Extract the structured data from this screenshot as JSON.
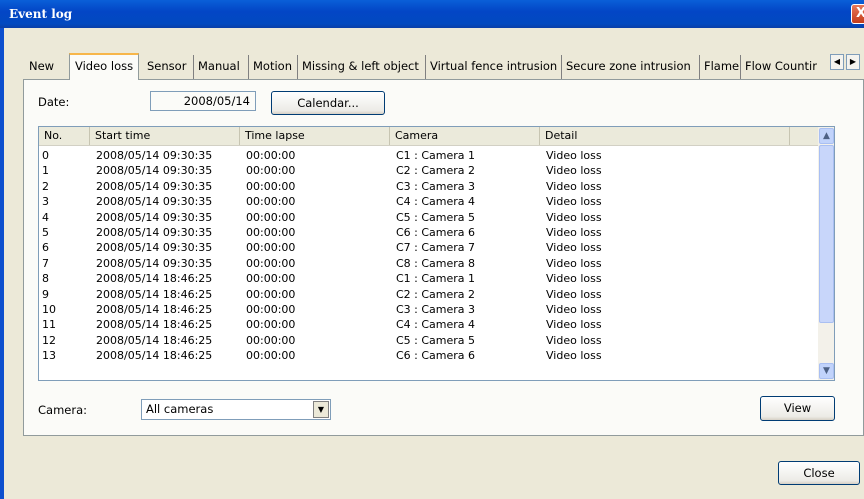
{
  "window": {
    "title": "Event log",
    "close_glyph": "X"
  },
  "tabs": [
    {
      "label": "New"
    },
    {
      "label": "Video loss"
    },
    {
      "label": "Sensor"
    },
    {
      "label": "Manual"
    },
    {
      "label": "Motion"
    },
    {
      "label": "Missing & left object"
    },
    {
      "label": "Virtual fence intrusion"
    },
    {
      "label": "Secure zone intrusion"
    },
    {
      "label": "Flame"
    },
    {
      "label": "Flow Countir"
    }
  ],
  "active_tab": "Video loss",
  "tab_nav": {
    "left_glyph": "◀",
    "right_glyph": "▶"
  },
  "date": {
    "label": "Date:",
    "value": "2008/05/14",
    "calendar_button": "Calendar..."
  },
  "table": {
    "columns": [
      "No.",
      "Start time",
      "Time lapse",
      "Camera",
      "Detail"
    ],
    "rows": [
      [
        "0",
        "2008/05/14 09:30:35",
        "00:00:00",
        "C1 : Camera 1",
        "Video loss"
      ],
      [
        "1",
        "2008/05/14 09:30:35",
        "00:00:00",
        "C2 : Camera 2",
        "Video loss"
      ],
      [
        "2",
        "2008/05/14 09:30:35",
        "00:00:00",
        "C3 : Camera 3",
        "Video loss"
      ],
      [
        "3",
        "2008/05/14 09:30:35",
        "00:00:00",
        "C4 : Camera 4",
        "Video loss"
      ],
      [
        "4",
        "2008/05/14 09:30:35",
        "00:00:00",
        "C5 : Camera 5",
        "Video loss"
      ],
      [
        "5",
        "2008/05/14 09:30:35",
        "00:00:00",
        "C6 : Camera 6",
        "Video loss"
      ],
      [
        "6",
        "2008/05/14 09:30:35",
        "00:00:00",
        "C7 : Camera 7",
        "Video loss"
      ],
      [
        "7",
        "2008/05/14 09:30:35",
        "00:00:00",
        "C8 : Camera 8",
        "Video loss"
      ],
      [
        "8",
        "2008/05/14 18:46:25",
        "00:00:00",
        "C1 : Camera 1",
        "Video loss"
      ],
      [
        "9",
        "2008/05/14 18:46:25",
        "00:00:00",
        "C2 : Camera 2",
        "Video loss"
      ],
      [
        "10",
        "2008/05/14 18:46:25",
        "00:00:00",
        "C3 : Camera 3",
        "Video loss"
      ],
      [
        "11",
        "2008/05/14 18:46:25",
        "00:00:00",
        "C4 : Camera 4",
        "Video loss"
      ],
      [
        "12",
        "2008/05/14 18:46:25",
        "00:00:00",
        "C5 : Camera 5",
        "Video loss"
      ],
      [
        "13",
        "2008/05/14 18:46:25",
        "00:00:00",
        "C6 : Camera 6",
        "Video loss"
      ]
    ],
    "scroll_up_glyph": "▲",
    "scroll_down_glyph": "▼"
  },
  "camera": {
    "label": "Camera:",
    "selected": "All cameras",
    "dropdown_glyph": "▼"
  },
  "buttons": {
    "view": "View",
    "close": "Close"
  },
  "colors": {
    "titlebar": "#0346c6",
    "tab_highlight": "#f7b64a",
    "dialog_bg": "#ece9d8"
  }
}
